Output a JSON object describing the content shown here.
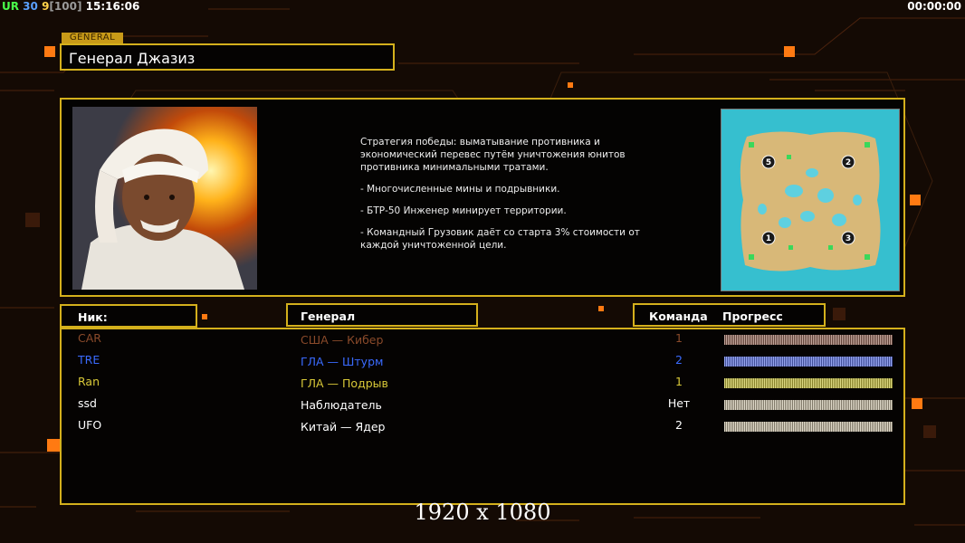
{
  "hud": {
    "tag": "UR",
    "num1": "30",
    "num2": "9",
    "bracket": "[100]",
    "clock": "15:16:06",
    "timer": "00:00:00"
  },
  "section_tag": "GENERAL",
  "general_name": "Генерал Джазиз",
  "description": [
    "Стратегия победы: выматывание противника и экономический перевес путём уничтожения юнитов противника минимальными тратами.",
    "- Многочисленные мины и подрывники.",
    "- БТР-50 Инженер минирует территории.",
    "- Командный Грузовик даёт со старта 3% стоимости от каждой уничтоженной цели."
  ],
  "minimap_spawns": [
    "5",
    "2",
    "1",
    "3"
  ],
  "headers": {
    "nick": "Ник:",
    "general": "Генерал",
    "team": "Команда",
    "progress": "Прогресс"
  },
  "players": [
    {
      "nick": "CAR",
      "general": "США — Кибер",
      "team": "1",
      "color": "#8a4a2a",
      "progress": 1.0
    },
    {
      "nick": "TRE",
      "general": "ГЛА — Штурм",
      "team": "2",
      "color": "#3a6bff",
      "progress": 1.0
    },
    {
      "nick": "Ran",
      "general": "ГЛА — Подрыв",
      "team": "1",
      "color": "#d8c838",
      "progress": 1.0
    },
    {
      "nick": "ssd",
      "general": "Наблюдатель",
      "team": "Нет",
      "color": "#ffffff",
      "progress": 1.0
    },
    {
      "nick": "UFO",
      "general": "Китай — Ядер",
      "team": "2",
      "color": "#ffffff",
      "progress": 1.0
    }
  ],
  "resolution": "1920 x 1080",
  "colors": {
    "accent_gold": "#d4b01c",
    "hud_orange": "#ff7a12",
    "bar_car": "#b07b6a",
    "bar_tre": "#6a84ff",
    "bar_ran": "#e0d84a",
    "bar_neutral": "#e8dcc0"
  }
}
